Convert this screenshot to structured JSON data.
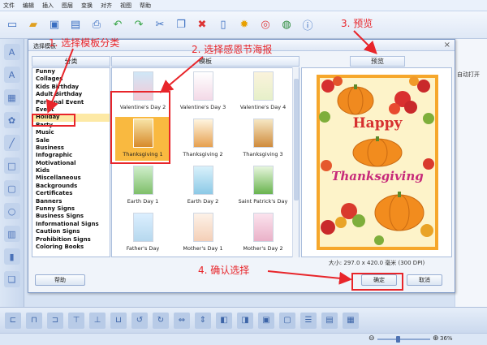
{
  "menu": [
    "文件",
    "编辑",
    "插入",
    "图层",
    "变换",
    "对齐",
    "视图",
    "帮助"
  ],
  "right_panel_text": "自动打开",
  "status": {
    "zoom": "36%"
  },
  "dialog": {
    "title": "选择模板",
    "categories_header": "分类",
    "templates_header": "模板",
    "preview_header": "预览",
    "categories": [
      "Funny",
      "Collages",
      "Kids Birthday",
      "Adult Birthday",
      "Personal Event",
      "Event",
      "Holiday",
      "Party",
      "Music",
      "Sale",
      "Business",
      "Infographic",
      "Motivational",
      "Kids",
      "Miscellaneous",
      "Backgrounds",
      "Certificates",
      "Banners",
      "Funny Signs",
      "Business Signs",
      "Informational Signs",
      "Caution Signs",
      "Prohibition Signs",
      "Coloring Books"
    ],
    "selected_category": "Holiday",
    "templates": [
      {
        "label": "Valentine's Day 2"
      },
      {
        "label": "Valentine's Day 3"
      },
      {
        "label": "Valentine's Day 4"
      },
      {
        "label": "Thanksgiving 1"
      },
      {
        "label": "Thanksgiving 2"
      },
      {
        "label": "Thanksgiving 3"
      },
      {
        "label": "Earth Day 1"
      },
      {
        "label": "Earth Day 2"
      },
      {
        "label": "Saint Patrick's Day"
      },
      {
        "label": "Father's Day"
      },
      {
        "label": "Mother's Day 1"
      },
      {
        "label": "Mother's Day 2"
      }
    ],
    "preview_text": {
      "line1": "Happy",
      "line2": "Thanksgiving"
    },
    "preview_size": "大小: 297.0 x 420.0 毫米 (300 DPI)",
    "help_button": "帮助",
    "ok_button": "确定",
    "cancel_button": "取消"
  },
  "annotations": {
    "step1": "1. 选择模板分类",
    "step2": "2. 选择感恩节海报",
    "step3": "3. 预览",
    "step4": "4. 确认选择"
  },
  "colors": {
    "annotation": "#e8252a",
    "selected_category": "#fde9a5",
    "selected_template": "#f9b940"
  }
}
